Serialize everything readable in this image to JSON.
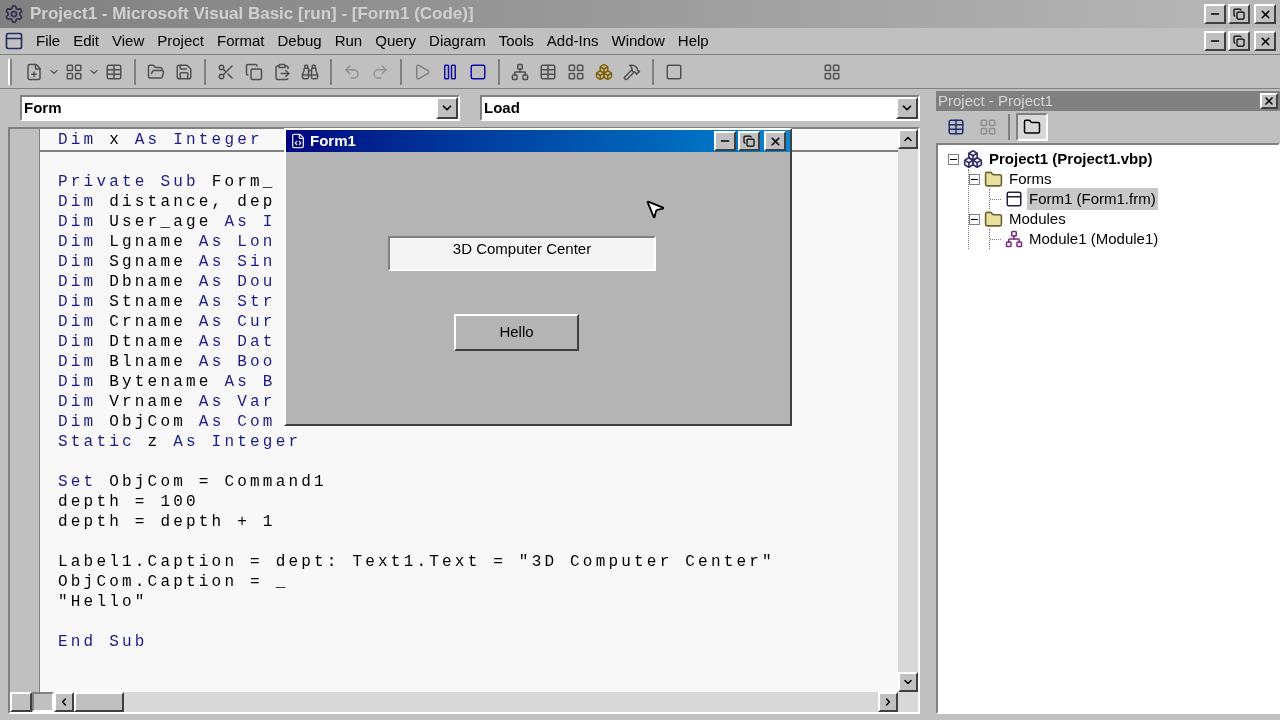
{
  "window": {
    "title": "Project1 - Microsoft Visual Basic [run] - [Form1 (Code)]"
  },
  "menu": [
    "File",
    "Edit",
    "View",
    "Project",
    "Format",
    "Debug",
    "Run",
    "Query",
    "Diagram",
    "Tools",
    "Add-Ins",
    "Window",
    "Help"
  ],
  "code_window": {
    "object_combo": "Form",
    "procedure_combo": "Load",
    "lines": [
      {
        "kind": "declaration",
        "parts": [
          {
            "text": "Dim",
            "keyword": true
          },
          {
            "text": " x ",
            "keyword": false
          },
          {
            "text": "As Integer",
            "keyword": true
          }
        ]
      },
      {
        "kind": "blank"
      },
      {
        "kind": "code",
        "parts": [
          {
            "text": "Private Sub",
            "keyword": true
          },
          {
            "text": " Form_",
            "keyword": false
          }
        ]
      },
      {
        "kind": "code",
        "parts": [
          {
            "text": "Dim",
            "keyword": true
          },
          {
            "text": " distance, dep",
            "keyword": false
          }
        ]
      },
      {
        "kind": "code",
        "parts": [
          {
            "text": "Dim",
            "keyword": true
          },
          {
            "text": " User_age ",
            "keyword": false
          },
          {
            "text": "As I",
            "keyword": true
          }
        ]
      },
      {
        "kind": "code",
        "parts": [
          {
            "text": "Dim",
            "keyword": true
          },
          {
            "text": " Lgname ",
            "keyword": false
          },
          {
            "text": "As Lon",
            "keyword": true
          }
        ]
      },
      {
        "kind": "code",
        "parts": [
          {
            "text": "Dim",
            "keyword": true
          },
          {
            "text": " Sgname ",
            "keyword": false
          },
          {
            "text": "As Sin",
            "keyword": true
          }
        ]
      },
      {
        "kind": "code",
        "parts": [
          {
            "text": "Dim",
            "keyword": true
          },
          {
            "text": " Dbname ",
            "keyword": false
          },
          {
            "text": "As Dou",
            "keyword": true
          }
        ]
      },
      {
        "kind": "code",
        "parts": [
          {
            "text": "Dim",
            "keyword": true
          },
          {
            "text": " Stname ",
            "keyword": false
          },
          {
            "text": "As Str",
            "keyword": true
          }
        ]
      },
      {
        "kind": "code",
        "parts": [
          {
            "text": "Dim",
            "keyword": true
          },
          {
            "text": " Crname ",
            "keyword": false
          },
          {
            "text": "As Cur",
            "keyword": true
          }
        ]
      },
      {
        "kind": "code",
        "parts": [
          {
            "text": "Dim",
            "keyword": true
          },
          {
            "text": " Dtname ",
            "keyword": false
          },
          {
            "text": "As Dat",
            "keyword": true
          }
        ]
      },
      {
        "kind": "code",
        "parts": [
          {
            "text": "Dim",
            "keyword": true
          },
          {
            "text": " Blname ",
            "keyword": false
          },
          {
            "text": "As Boo",
            "keyword": true
          }
        ]
      },
      {
        "kind": "code",
        "parts": [
          {
            "text": "Dim",
            "keyword": true
          },
          {
            "text": " Bytename ",
            "keyword": false
          },
          {
            "text": "As B",
            "keyword": true
          }
        ]
      },
      {
        "kind": "code",
        "parts": [
          {
            "text": "Dim",
            "keyword": true
          },
          {
            "text": " Vrname ",
            "keyword": false
          },
          {
            "text": "As Var",
            "keyword": true
          }
        ]
      },
      {
        "kind": "code",
        "parts": [
          {
            "text": "Dim",
            "keyword": true
          },
          {
            "text": " ObjCom ",
            "keyword": false
          },
          {
            "text": "As Com",
            "keyword": true
          }
        ]
      },
      {
        "kind": "code",
        "parts": [
          {
            "text": "Static",
            "keyword": true
          },
          {
            "text": " z ",
            "keyword": false
          },
          {
            "text": "As Integer",
            "keyword": true
          }
        ]
      },
      {
        "kind": "blank"
      },
      {
        "kind": "code",
        "parts": [
          {
            "text": "Set",
            "keyword": true
          },
          {
            "text": " ObjCom = Command1",
            "keyword": false
          }
        ]
      },
      {
        "kind": "code",
        "parts": [
          {
            "text": "depth = 100",
            "keyword": false
          }
        ]
      },
      {
        "kind": "code",
        "parts": [
          {
            "text": "depth = depth + 1",
            "keyword": false
          }
        ]
      },
      {
        "kind": "blank"
      },
      {
        "kind": "code",
        "parts": [
          {
            "text": "Label1.Caption = dept: Text1.Text = \"3D Computer Center\"",
            "keyword": false
          }
        ]
      },
      {
        "kind": "code",
        "parts": [
          {
            "text": "ObjCom.Caption = _",
            "keyword": false
          }
        ]
      },
      {
        "kind": "code",
        "parts": [
          {
            "text": "\"Hello\"",
            "keyword": false
          }
        ]
      },
      {
        "kind": "blank"
      },
      {
        "kind": "code",
        "parts": [
          {
            "text": "End Sub",
            "keyword": true
          }
        ]
      }
    ]
  },
  "form_window": {
    "title": "Form1",
    "textbox": "3D Computer Center",
    "button": "Hello"
  },
  "project_panel": {
    "title": "Project - Project1",
    "tree": [
      {
        "label": "Project1 (Project1.vbp)",
        "kind": "project",
        "expanded": true,
        "selected": false,
        "children": [
          {
            "label": "Forms",
            "kind": "folder",
            "expanded": true,
            "selected": false,
            "children": [
              {
                "label": "Form1 (Form1.frm)",
                "kind": "form",
                "selected": true
              }
            ]
          },
          {
            "label": "Modules",
            "kind": "folder",
            "expanded": true,
            "selected": false,
            "children": [
              {
                "label": "Module1 (Module1)",
                "kind": "module",
                "selected": false
              }
            ]
          }
        ]
      }
    ]
  }
}
